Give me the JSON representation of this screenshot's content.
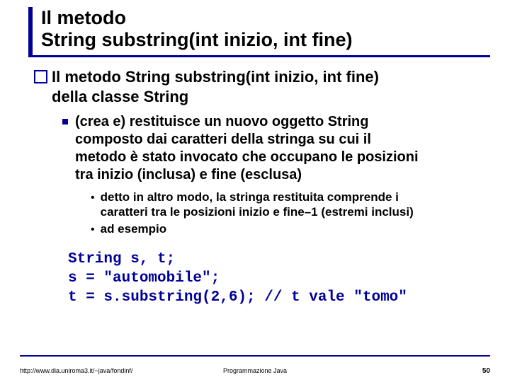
{
  "title_line1": "Il metodo",
  "title_line2": "String substring(int inizio, int fine)",
  "q": {
    "prefix": "Il metodo ",
    "bold": "String substring(int inizio, int fine)",
    "line2a": "della classe ",
    "line2b": "String"
  },
  "s": {
    "l1": "(crea e) restituisce un nuovo oggetto String",
    "l2": "composto dai caratteri della stringa su cui il",
    "l3": "metodo è stato invocato che occupano le posizioni",
    "l4": "tra inizio (inclusa) e fine (esclusa)"
  },
  "d1": {
    "l1": "detto in altro modo, la stringa restituita comprende i",
    "l2": "caratteri tra le posizioni inizio e fine–1 (estremi inclusi)"
  },
  "d2": "ad esempio",
  "code": "String s, t;\ns = \"automobile\";\nt = s.substring(2,6); // t vale \"tomo\"",
  "footer": {
    "left": "http://www.dia.uniroma3.it/~java/fondinf/",
    "center": "Programmazione Java",
    "right": "50"
  }
}
